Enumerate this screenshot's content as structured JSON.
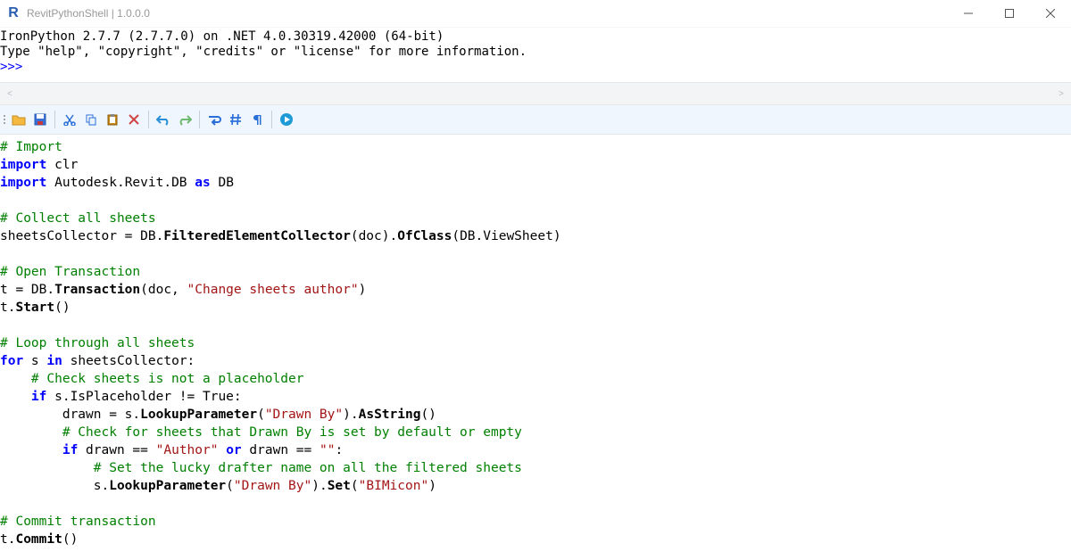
{
  "window": {
    "title": "RevitPythonShell | 1.0.0.0"
  },
  "console": {
    "line1": "IronPython 2.7.7 (2.7.7.0) on .NET 4.0.30319.42000 (64-bit)",
    "line2": "Type \"help\", \"copyright\", \"credits\" or \"license\" for more information.",
    "prompt": ">>>"
  },
  "nav": {
    "left": "<",
    "right": ">"
  },
  "toolbar": {
    "icons": [
      "open-icon",
      "save-icon",
      "cut-icon",
      "copy-icon",
      "paste-icon",
      "delete-icon",
      "undo-icon",
      "redo-icon",
      "wrap-icon",
      "hash-icon",
      "pilcrow-icon",
      "run-icon"
    ]
  },
  "code": {
    "c1": "# Import",
    "kw_import1": "import",
    "t_clr": " clr",
    "kw_import2": "import",
    "t_ar": " Autodesk.Revit.DB ",
    "kw_as": "as",
    "t_db": " DB",
    "c2": "# Collect all sheets",
    "l_sc1": "sheetsCollector = DB.",
    "l_sc2": "FilteredElementCollector",
    "l_sc3": "(doc).",
    "l_sc4": "OfClass",
    "l_sc5": "(DB.ViewSheet)",
    "c3": "# Open Transaction",
    "l_t1": "t = DB.",
    "l_t2": "Transaction",
    "l_t3": "(doc, ",
    "s_t": "\"Change sheets author\"",
    "l_t4": ")",
    "l_st1": "t.",
    "l_st2": "Start",
    "l_st3": "()",
    "c4": "# Loop through all sheets",
    "kw_for": "for",
    "l_for1": " s ",
    "kw_in": "in",
    "l_for2": " sheetsCollector:",
    "c5": "    # Check sheets is not a placeholder",
    "kw_if1": "if",
    "l_if1": " s.IsPlaceholder != True:",
    "l_dr1": "        drawn = s.",
    "l_dr2": "LookupParameter",
    "l_dr3": "(",
    "s_dr": "\"Drawn By\"",
    "l_dr4": ").",
    "l_dr5": "AsString",
    "l_dr6": "()",
    "c6": "        # Check for sheets that Drawn By is set by default or empty",
    "kw_if2": "if",
    "l_if2a": " drawn == ",
    "s_if2a": "\"Author\"",
    "l_if2b": " ",
    "kw_or": "or",
    "l_if2c": " drawn == ",
    "s_if2b": "\"\"",
    "l_if2d": ":",
    "c7": "            # Set the lucky drafter name on all the filtered sheets",
    "l_set1": "            s.",
    "l_set2": "LookupParameter",
    "l_set3": "(",
    "s_set1": "\"Drawn By\"",
    "l_set4": ").",
    "l_set5": "Set",
    "l_set6": "(",
    "s_set2": "\"BIMicon\"",
    "l_set7": ")",
    "c8": "# Commit transaction",
    "l_cm1": "t.",
    "l_cm2": "Commit",
    "l_cm3": "()",
    "pad_if1": "    ",
    "pad_if2": "        "
  }
}
